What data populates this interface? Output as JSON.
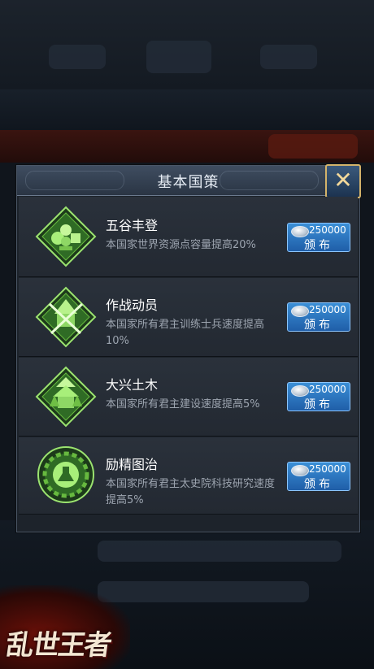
{
  "dialog": {
    "title": "基本国策"
  },
  "policies": [
    {
      "name": "五谷丰登",
      "description": "本国家世界资源点容量提高20%",
      "cost": "250000",
      "button_label": "颁布",
      "icon": "harvest-icon"
    },
    {
      "name": "作战动员",
      "description": "本国家所有君主训练士兵速度提高10%",
      "cost": "250000",
      "button_label": "颁布",
      "icon": "battle-mobilization-icon"
    },
    {
      "name": "大兴土木",
      "description": "本国家所有君主建设速度提高5%",
      "cost": "250000",
      "button_label": "颁布",
      "icon": "construction-icon"
    },
    {
      "name": "励精图治",
      "description": "本国家所有君主太史院科技研究速度提高5%",
      "cost": "250000",
      "button_label": "颁布",
      "icon": "research-icon"
    }
  ],
  "logo_text": "乱世王者",
  "colors": {
    "accent_blue": "#2a75c2",
    "icon_green": "#5fbf3a",
    "gold_border": "#d4b36a"
  }
}
